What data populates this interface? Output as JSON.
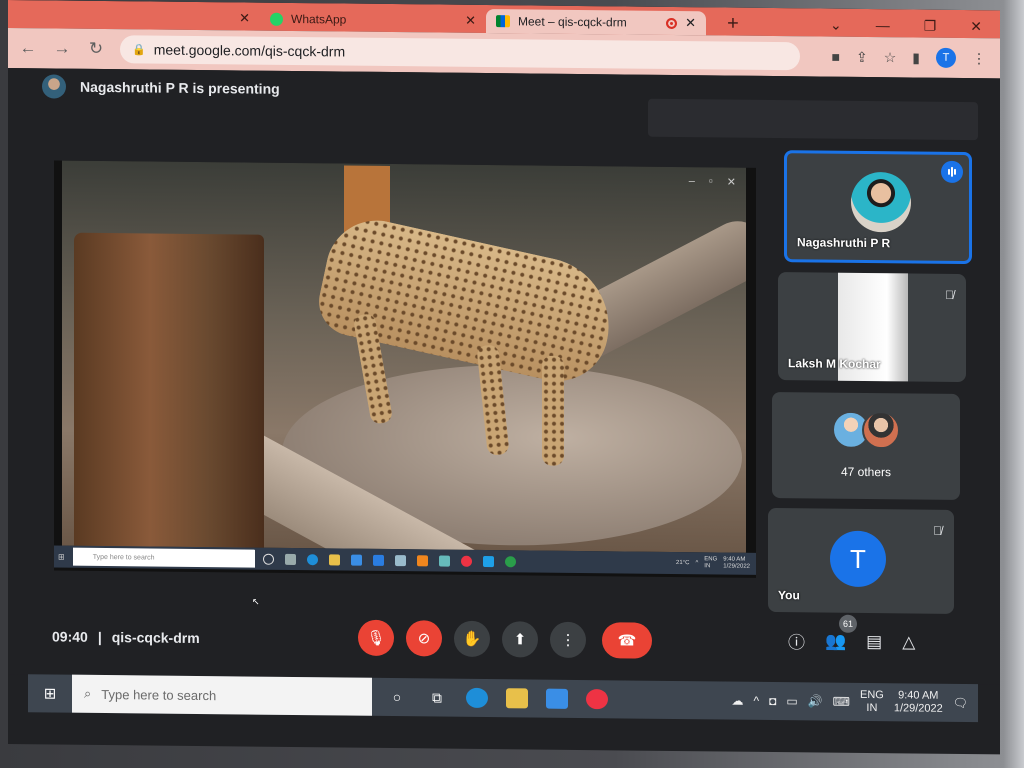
{
  "browser": {
    "tabs": [
      {
        "label": "WhatsApp",
        "active": false
      },
      {
        "label": "Meet – qis-cqck-drm",
        "active": true
      }
    ],
    "url": "meet.google.com/qis-cqck-drm",
    "profile_initial": "T"
  },
  "meet": {
    "presenting_text": "Nagashruthi P R is presenting",
    "time": "09:40",
    "separator": "|",
    "meeting_code": "qis-cqck-drm",
    "participant_count": "61",
    "tiles": [
      {
        "name": "Nagashruthi P R",
        "speaking": true
      },
      {
        "name": "Laksh M Kochar",
        "muted": true
      },
      {
        "label": "47 others"
      },
      {
        "name": "You",
        "initial": "T",
        "muted": true
      }
    ]
  },
  "shared_screen": {
    "search_placeholder": "Type here to search",
    "temperature": "21°C",
    "lang": "ENG",
    "region": "IN",
    "time": "9:40 AM",
    "date": "1/29/2022"
  },
  "taskbar": {
    "search_placeholder": "Type here to search",
    "lang": "ENG",
    "region": "IN",
    "time": "9:40 AM",
    "date": "1/29/2022"
  },
  "colors": {
    "browser_tab_bar": "#e5695a",
    "meet_bg": "#202124",
    "accent_blue": "#1a73e8",
    "end_call_red": "#ea4335"
  }
}
